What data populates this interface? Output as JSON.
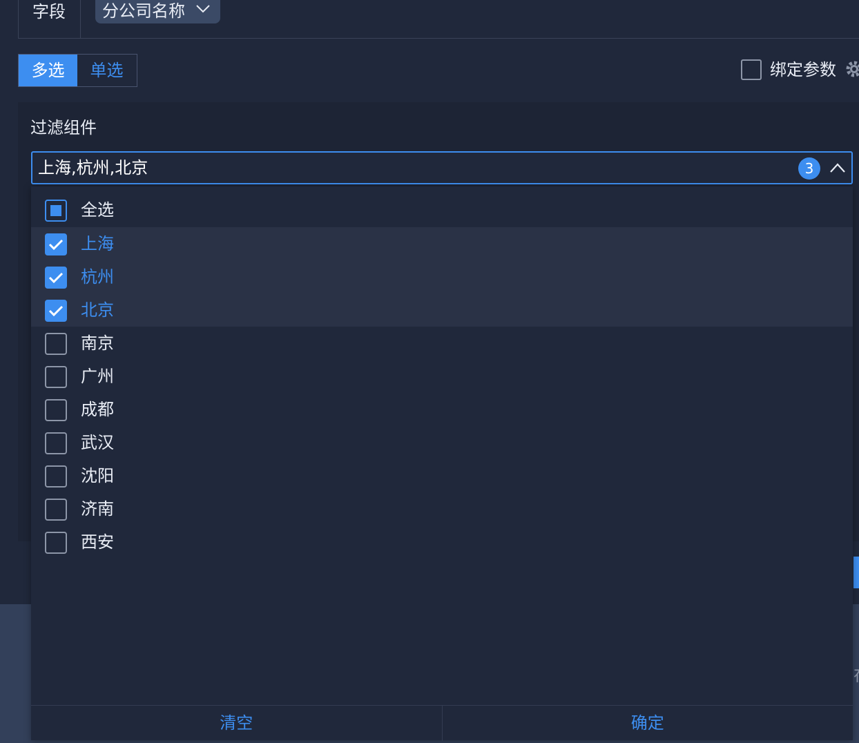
{
  "field": {
    "label": "字段",
    "dropdown_value": "分公司名称"
  },
  "mode": {
    "multi": "多选",
    "single": "单选",
    "active": "多选"
  },
  "bind": {
    "label": "绑定参数",
    "checked": false
  },
  "filter": {
    "title": "过滤组件",
    "selected_text": "上海,杭州,北京",
    "selected_count": "3",
    "select_all": {
      "label": "全选",
      "state": "partial"
    },
    "options": [
      {
        "label": "上海",
        "checked": true
      },
      {
        "label": "杭州",
        "checked": true
      },
      {
        "label": "北京",
        "checked": true
      },
      {
        "label": "南京",
        "checked": false
      },
      {
        "label": "广州",
        "checked": false
      },
      {
        "label": "成都",
        "checked": false
      },
      {
        "label": "武汉",
        "checked": false
      },
      {
        "label": "沈阳",
        "checked": false
      },
      {
        "label": "济南",
        "checked": false
      },
      {
        "label": "西安",
        "checked": false
      }
    ],
    "clear_label": "清空",
    "confirm_label": "确定"
  },
  "colors": {
    "accent": "#3d8ef0",
    "background": "#20283b",
    "panel": "#1d2435",
    "selected_row": "#2a3246"
  }
}
